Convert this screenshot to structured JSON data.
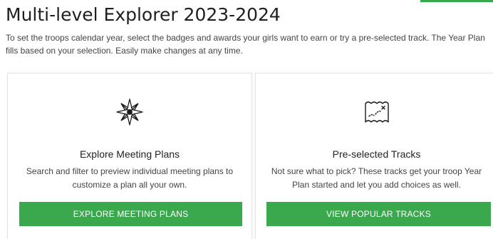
{
  "header": {
    "title": "Multi-level Explorer 2023-2024",
    "intro": "To set the troops calendar year, select the badges and awards your girls want to earn or try a pre-selected track. The Year Plan fills based on your selection. Easily make changes at any time."
  },
  "cards": [
    {
      "icon": "compass-star-icon",
      "title": "Explore Meeting Plans",
      "description": "Search and filter to preview individual meeting plans to customize a plan all your own.",
      "button_label": "EXPLORE MEETING PLANS"
    },
    {
      "icon": "treasure-map-icon",
      "title": "Pre-selected Tracks",
      "description": "Not sure what to pick? These tracks get your troop Year Plan started and let you add choices as well.",
      "button_label": "VIEW POPULAR TRACKS"
    }
  ],
  "colors": {
    "accent": "#3aa84d",
    "text": "#222222",
    "muted_text": "#444444",
    "card_border": "#e3e3e3"
  }
}
